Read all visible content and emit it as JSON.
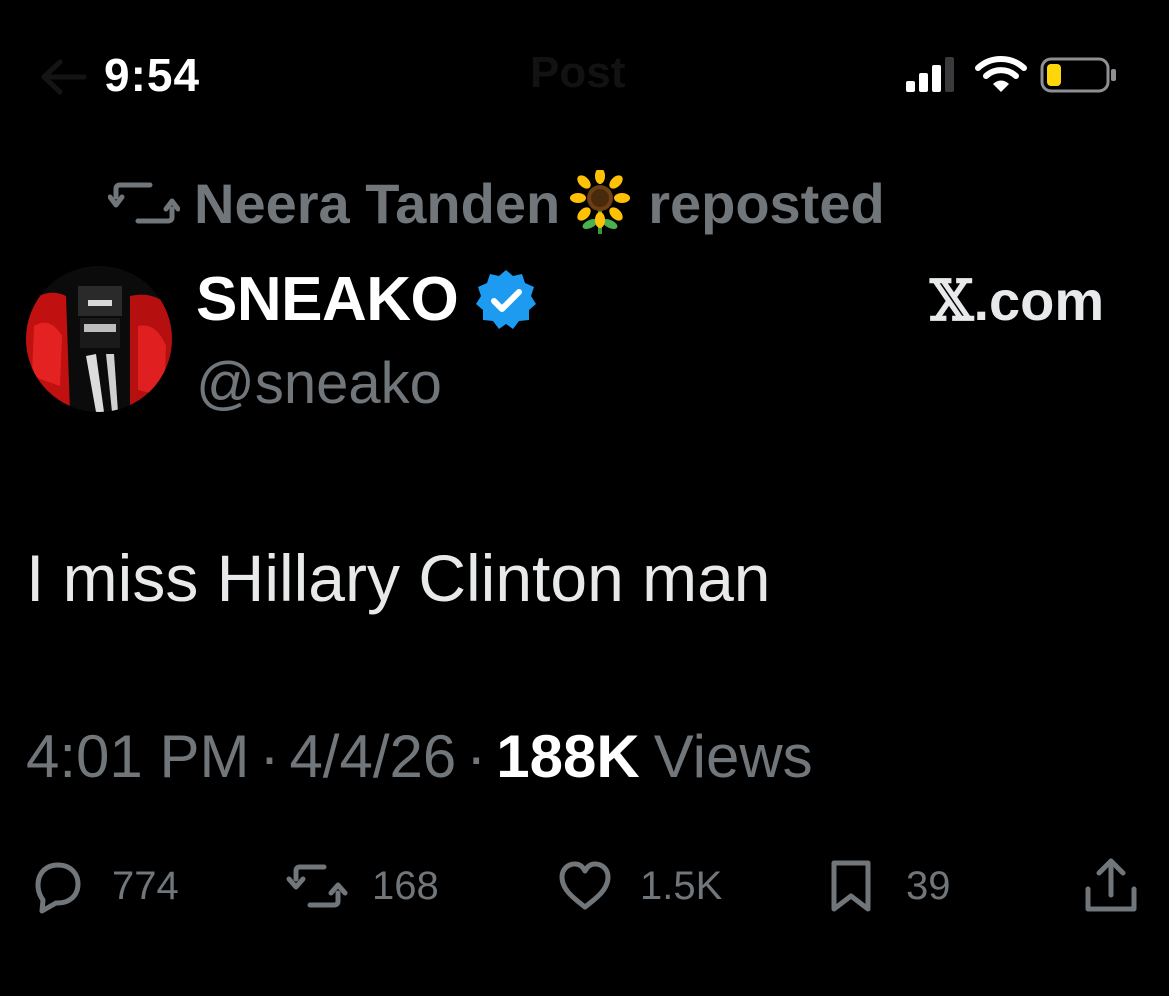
{
  "status_bar": {
    "time": "9:54",
    "nav_title": "Post"
  },
  "repost": {
    "user": "Neera Tanden",
    "emoji": "🌻",
    "label": "reposted"
  },
  "author": {
    "name": "SNEAKO",
    "handle": "@sneako",
    "verified": true
  },
  "source": {
    "brand_x": "𝕏",
    "brand_suffix": ".com"
  },
  "tweet": {
    "text": "I miss Hillary Clinton man",
    "time": "4:01 PM",
    "date": "4/4/26",
    "views_count": "188K",
    "views_label": "Views",
    "separator": "·"
  },
  "actions": {
    "replies": "774",
    "reposts": "168",
    "likes": "1.5K",
    "bookmarks": "39"
  },
  "colors": {
    "background": "#000000",
    "primary_text": "#e7e9ea",
    "secondary_text": "#71767b",
    "verified_blue": "#1d9bf0",
    "battery_yellow": "#ffd60a"
  },
  "icons": {
    "back": "back-arrow-icon",
    "signal": "cellular-signal-icon",
    "wifi": "wifi-icon",
    "battery": "battery-low-icon",
    "repost": "repost-icon",
    "verified": "verified-badge-icon",
    "reply": "reply-icon",
    "like": "heart-icon",
    "bookmark": "bookmark-icon",
    "share": "share-icon"
  }
}
